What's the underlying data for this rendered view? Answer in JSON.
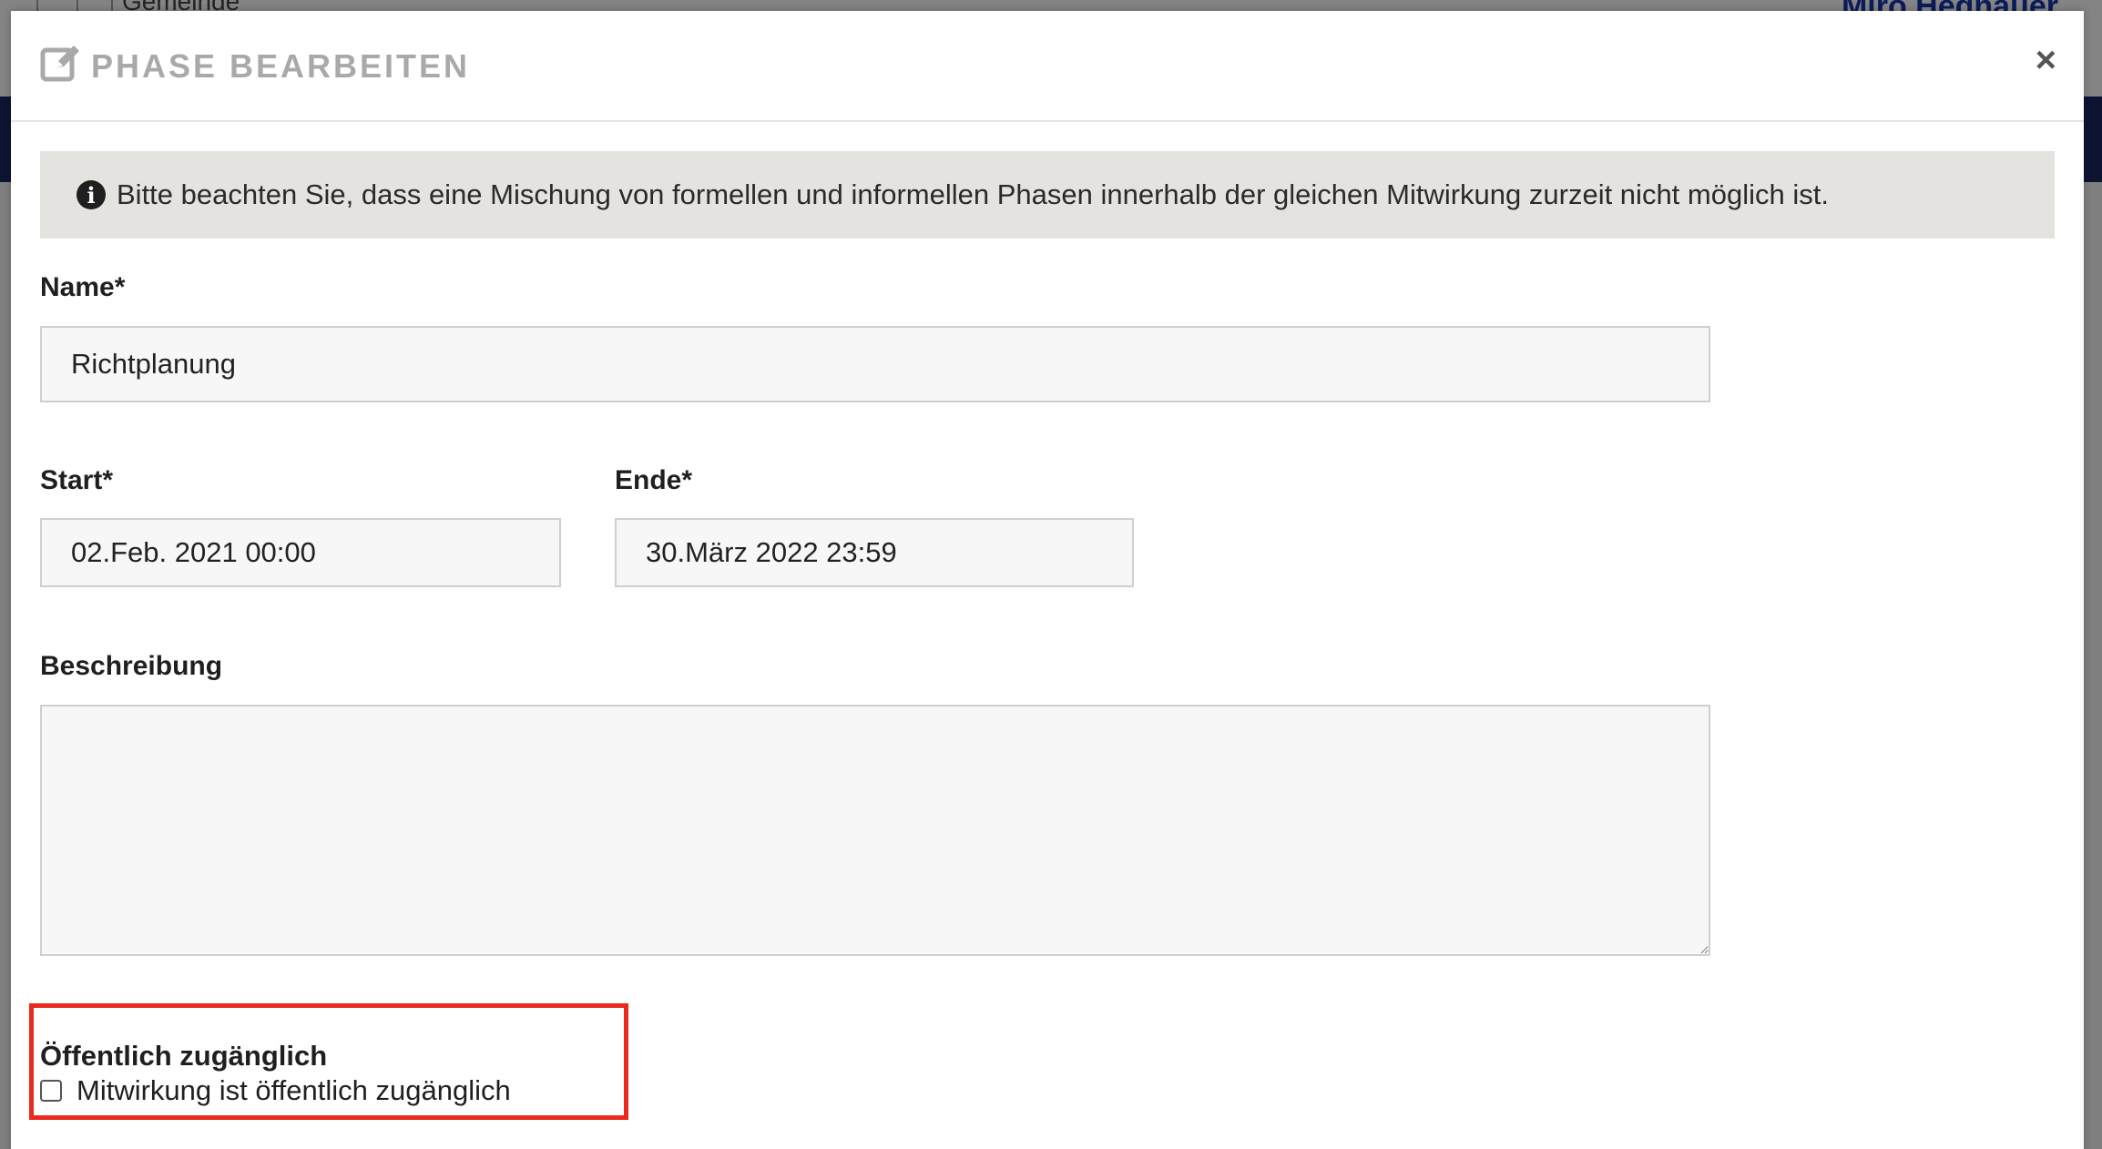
{
  "background": {
    "municipality_label": "Gemeinde",
    "user_name": "Miro Hegnauer"
  },
  "modal": {
    "title": "PHASE BEARBEITEN",
    "edit_icon": "edit-icon",
    "close_label": "×",
    "info": {
      "icon": "info-circle-icon",
      "text": "Bitte beachten Sie, dass eine Mischung von formellen und informellen Phasen innerhalb der gleichen Mitwirkung zurzeit nicht möglich ist."
    },
    "fields": {
      "name": {
        "label": "Name*",
        "value": "Richtplanung"
      },
      "start": {
        "label": "Start*",
        "value": "02.Feb. 2021 00:00"
      },
      "end": {
        "label": "Ende*",
        "value": "30.März 2022 23:59"
      },
      "description": {
        "label": "Beschreibung",
        "value": ""
      },
      "public": {
        "label": "Öffentlich zugänglich",
        "checkbox_label": "Mitwirkung ist öffentlich zugänglich",
        "checked": false
      }
    }
  },
  "colors": {
    "highlight": "#ea2a1c",
    "nav_band": "#0c1432",
    "info_banner": "#e5e3df",
    "title_gray": "#a9a9a9"
  }
}
